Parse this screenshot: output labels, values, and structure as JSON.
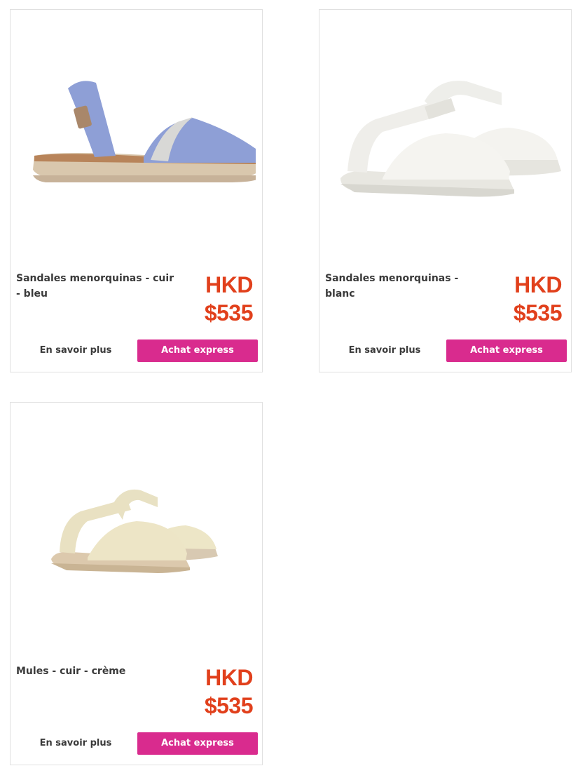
{
  "products": [
    {
      "name": "Sandales menorquinas - cuir - bleu",
      "currency": "HKD",
      "price": "$535",
      "learn_more": "En savoir plus",
      "express": "Achat express",
      "image_icon": "blue-sandal-image"
    },
    {
      "name": "Sandales menorquinas - blanc",
      "currency": "HKD",
      "price": "$535",
      "learn_more": "En savoir plus",
      "express": "Achat express",
      "image_icon": "white-sandals-image"
    },
    {
      "name": "Mules - cuir - crème",
      "currency": "HKD",
      "price": "$535",
      "learn_more": "En savoir plus",
      "express": "Achat express",
      "image_icon": "cream-sandals-image"
    }
  ],
  "colors": {
    "price": "#e1401c",
    "express_button": "#d92b8e",
    "text": "#3a3a3a",
    "card_border": "#e0e0e0"
  }
}
